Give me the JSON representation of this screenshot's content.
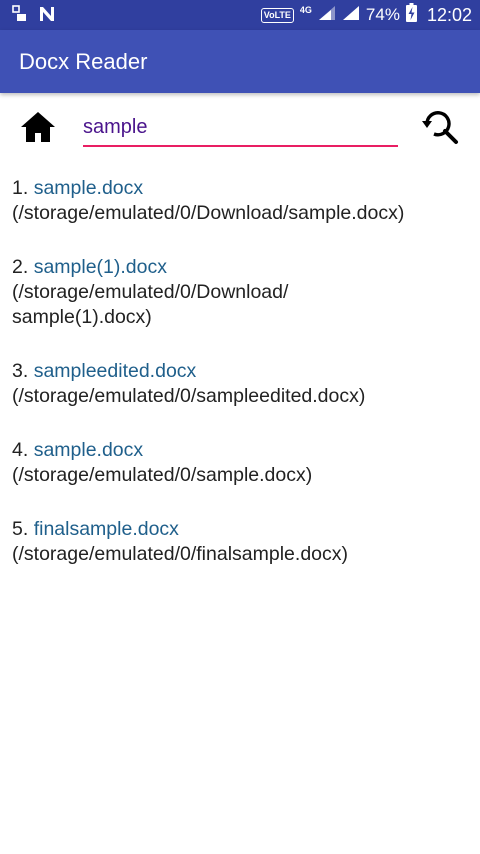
{
  "status_bar": {
    "volte": "VoLTE",
    "network": "4G",
    "battery": "74%",
    "time": "12:02"
  },
  "app_bar": {
    "title": "Docx Reader"
  },
  "search": {
    "value": "sample"
  },
  "results": [
    {
      "index": "1.",
      "name": "sample.docx",
      "path": "(/storage/emulated/0/Download/sample.docx)"
    },
    {
      "index": "2.",
      "name": "sample(1).docx",
      "path_line1": "(/storage/emulated/0/Download/",
      "path_line2": "sample(1).docx)"
    },
    {
      "index": "3.",
      "name": "sampleedited.docx",
      "path": "(/storage/emulated/0/sampleedited.docx)"
    },
    {
      "index": "4.",
      "name": "sample.docx",
      "path": "(/storage/emulated/0/sample.docx)"
    },
    {
      "index": "5.",
      "name": "finalsample.docx",
      "path": "(/storage/emulated/0/finalsample.docx)"
    }
  ],
  "colors": {
    "status_bar": "#303F9F",
    "app_bar": "#3F51B5",
    "input_underline": "#E91E63",
    "input_text": "#4A148C",
    "link": "#1F5F8B"
  },
  "icons": {
    "status_left": [
      "image-icon",
      "notification-n-icon"
    ],
    "status_right": [
      "volte-icon",
      "signal-icon",
      "battery-charging-icon"
    ],
    "home": "home-icon",
    "search": "search-refresh-icon"
  }
}
